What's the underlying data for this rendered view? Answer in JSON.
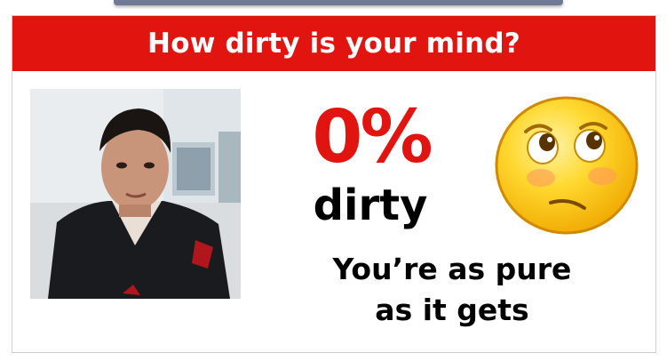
{
  "quiz": {
    "title": "How dirty is your mind?",
    "result_percent": "0%",
    "result_word": "dirty",
    "message": "You’re as pure as it gets"
  },
  "icons": {
    "profile_photo": "profile-photo",
    "emoji": "pleading-face-emoji"
  },
  "colors": {
    "accent": "#e1140f",
    "emoji_yellow": "#ffcf2a"
  }
}
